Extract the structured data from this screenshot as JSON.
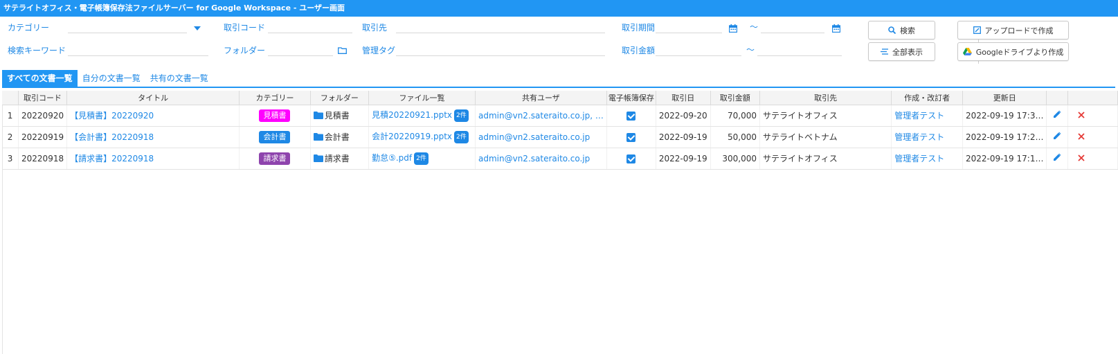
{
  "window": {
    "title": "サテライトオフィス・電子帳簿保存法ファイルサーバー for Google Workspace - ユーザー画面"
  },
  "search": {
    "category_label": "カテゴリー",
    "deal_code_label": "取引コード",
    "partner_label": "取引先",
    "period_label": "取引期間",
    "tilde": "～",
    "keyword_label": "検索キーワード",
    "folder_label": "フォルダー",
    "tag_label": "管理タグ",
    "amount_label": "取引金額",
    "search_button": "検索",
    "show_all_button": "全部表示",
    "upload_button": "アップロードで作成",
    "drive_button": "Googleドライブより作成"
  },
  "tabs": [
    "すべての文書一覧",
    "自分の文書一覧",
    "共有の文書一覧"
  ],
  "table": {
    "headers": [
      "",
      "取引コード",
      "タイトル",
      "カテゴリー",
      "フォルダー",
      "ファイル一覧",
      "共有ユーザ",
      "電子帳簿保存",
      "取引日",
      "取引金額",
      "取引先",
      "作成・改訂者",
      "更新日",
      "",
      ""
    ],
    "rows": [
      {
        "no": "1",
        "code": "20220920",
        "title": "【見積書】20220920",
        "category": "見積書",
        "category_color": "#ff00ff",
        "folder": "見積書",
        "file": "見積20220921.pptx",
        "file_count": "2件",
        "shared": "admin@vn2.sateraito.co.jp, …",
        "date": "2022-09-20",
        "amount": "70,000",
        "partner": "サテライトオフィス",
        "author": "管理者テスト",
        "updated": "2022-09-19 17:3…"
      },
      {
        "no": "2",
        "code": "20220919",
        "title": "【会計書】20220918",
        "category": "会計書",
        "category_color": "#1e88e5",
        "folder": "会計書",
        "file": "会計20220919.pptx",
        "file_count": "2件",
        "shared": "admin@vn2.sateraito.co.jp",
        "date": "2022-09-19",
        "amount": "50,000",
        "partner": "サテライトベトナム",
        "author": "管理者テスト",
        "updated": "2022-09-19 17:2…"
      },
      {
        "no": "3",
        "code": "20220918",
        "title": "【請求書】20220918",
        "category": "請求書",
        "category_color": "#8e44ad",
        "folder": "請求書",
        "file": "勤怠⑤.pdf",
        "file_count": "2件",
        "shared": "admin@vn2.sateraito.co.jp",
        "date": "2022-09-19",
        "amount": "300,000",
        "partner": "サテライトオフィス",
        "author": "管理者テスト",
        "updated": "2022-09-19 17:1…"
      }
    ]
  },
  "icons": {
    "calendar": "calendar-icon",
    "folder": "folder-icon",
    "search": "search-icon",
    "edit": "pencil-icon",
    "delete": "close-icon",
    "dropdown": "caret-down-icon"
  }
}
